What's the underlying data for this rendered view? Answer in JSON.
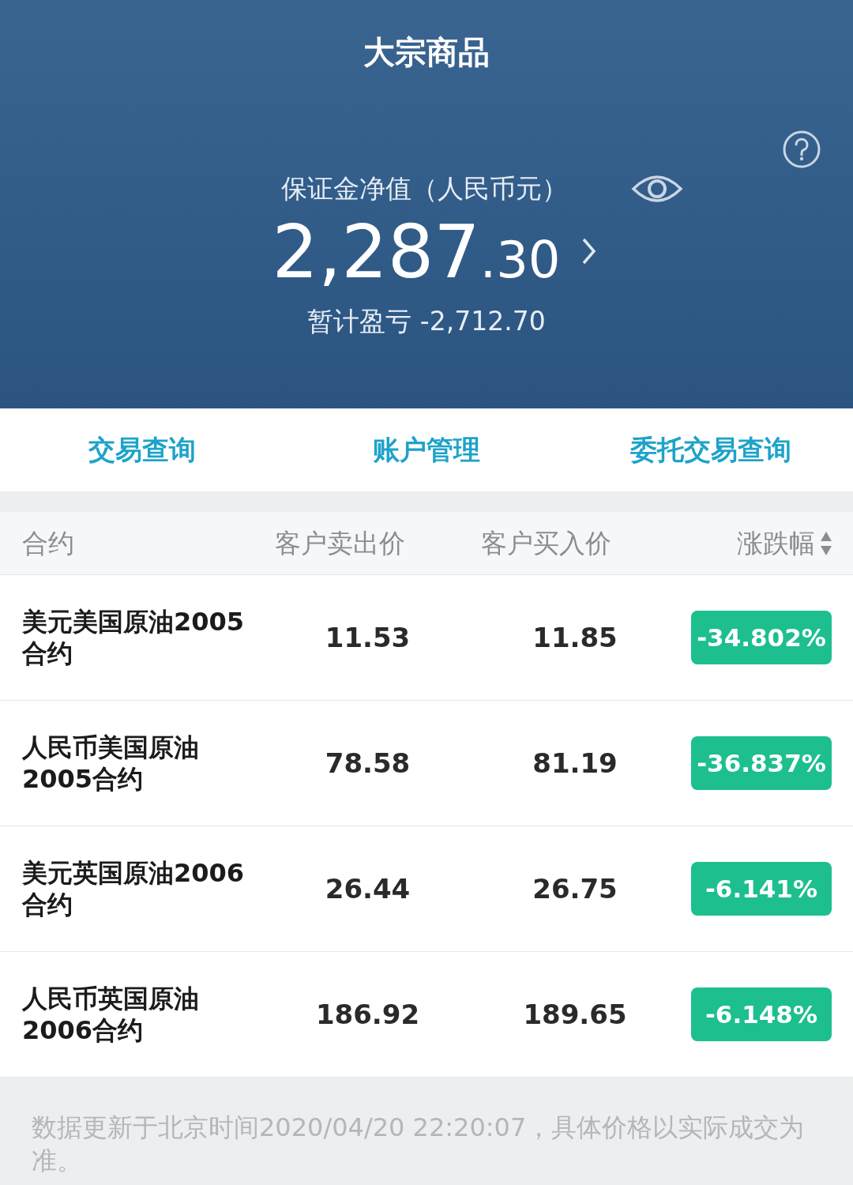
{
  "title": "大宗商品",
  "balance": {
    "label": "保证金净值（人民币元）",
    "amount_integer": "2,287",
    "amount_decimal": ".30",
    "pnl": "暂计盈亏 -2,712.70"
  },
  "nav": [
    "交易查询",
    "账户管理",
    "委托交易查询"
  ],
  "columns": [
    "合约",
    "客户卖出价",
    "客户买入价",
    "涨跌幅"
  ],
  "rows": [
    {
      "name": "美元美国原油2005合约",
      "sell": "11.53",
      "buy": "11.85",
      "change": "-34.802%"
    },
    {
      "name": "人民币美国原油2005合约",
      "sell": "78.58",
      "buy": "81.19",
      "change": "-36.837%"
    },
    {
      "name": "美元英国原油2006合约",
      "sell": "26.44",
      "buy": "26.75",
      "change": "-6.141%"
    },
    {
      "name": "人民币英国原油2006合约",
      "sell": "186.92",
      "buy": "189.65",
      "change": "-6.148%"
    }
  ],
  "footer": "数据更新于北京时间2020/04/20 22:20:07，具体价格以实际成交为准。"
}
